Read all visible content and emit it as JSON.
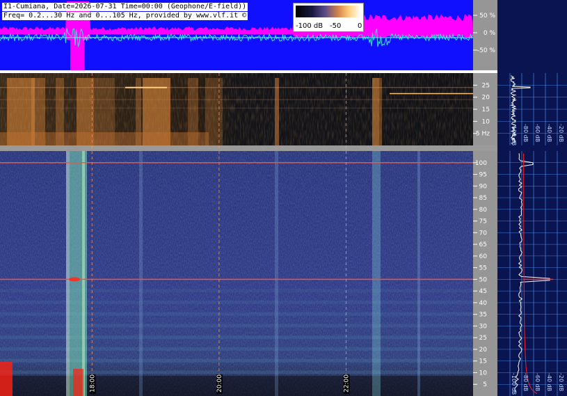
{
  "header": {
    "line1": "I1-Cumiana, Date=2026-07-31 Time=00:00 (Geophone/E-field))",
    "line2": "Freq= 0.2...30 Hz and 0...105 Hz, provided by www.vlf.it ©"
  },
  "colorbar": {
    "labels": [
      "-100 dB",
      "-50",
      "0"
    ]
  },
  "colors": {
    "signal_bg": "#1010ff",
    "signal_amp": "#ff00ff",
    "signal_trace": "#40e0e0",
    "spec_bg": "#2a3580",
    "spec_low_bg": "#141416",
    "axis_bg": "#969696",
    "right_bg": "#0a1450",
    "grid": "#50a0ff",
    "marker_line": "#ff6040",
    "profile_trace": "#ffffff",
    "profile_fit": "#ff2020"
  },
  "chart_data": [
    {
      "type": "line",
      "title": "",
      "xlabel": "",
      "ylabel": "",
      "yticks": [
        "50 %",
        "0 %",
        "-50 %"
      ],
      "ylim": [
        -100,
        100
      ]
    },
    {
      "type": "heatmap",
      "title": "",
      "ylabel": "Hz",
      "yticks": [
        "25",
        "20",
        "15",
        "10",
        "5 Hz"
      ],
      "ylim": [
        0,
        30
      ],
      "profile_xticks": [
        "-100 dB",
        "-80 dB",
        "-60 dB",
        "-40 dB",
        "-20 dB"
      ],
      "annotations": [
        "continuous horizontal tones near 24 Hz and 19 Hz",
        "broadband activity strongest before 18:00 and near 22:15"
      ]
    },
    {
      "type": "heatmap",
      "title": "",
      "ylabel": "Hz",
      "xticks": [
        "18:00",
        "20:00",
        "22:00"
      ],
      "x_markers_hours": [
        18.0,
        20.0,
        22.0
      ],
      "x_range_hours": [
        16.55,
        24.0
      ],
      "yticks": [
        "100",
        "95",
        "90",
        "85",
        "80",
        "75",
        "70",
        "65",
        "60",
        "55",
        "50",
        "45",
        "40",
        "35",
        "30",
        "25",
        "20",
        "15",
        "10",
        "5"
      ],
      "ylim": [
        0,
        105
      ],
      "lines_hz": [
        100,
        50
      ],
      "profile_xticks": [
        "-100 dB",
        "-80 dB",
        "-60 dB",
        "-40 dB",
        "-20 dB"
      ]
    }
  ]
}
